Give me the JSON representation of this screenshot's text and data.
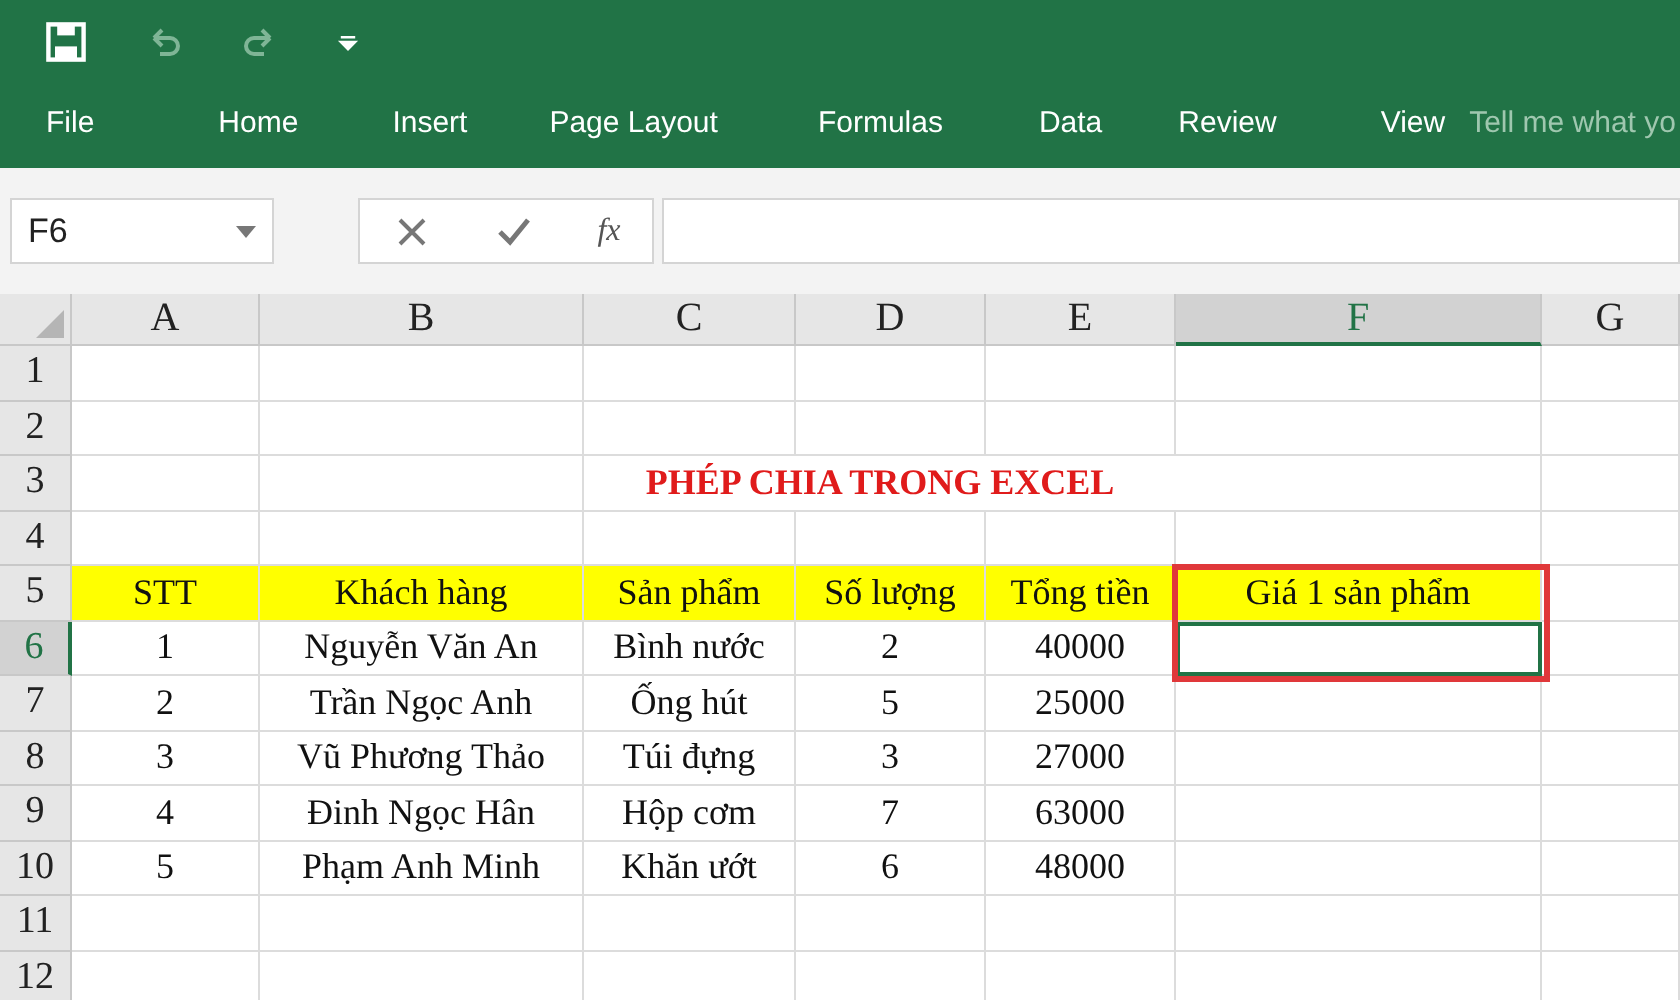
{
  "ribbon": {
    "tabs": [
      "File",
      "Home",
      "Insert",
      "Page Layout",
      "Formulas",
      "Data",
      "Review",
      "View"
    ],
    "tell_me": "Tell me what yo"
  },
  "formula_bar": {
    "name_box": "F6",
    "function_label": "fx"
  },
  "sheet": {
    "columns": [
      {
        "label": "A",
        "selected": false
      },
      {
        "label": "B",
        "selected": false
      },
      {
        "label": "C",
        "selected": false
      },
      {
        "label": "D",
        "selected": false
      },
      {
        "label": "E",
        "selected": false
      },
      {
        "label": "F",
        "selected": true
      },
      {
        "label": "G",
        "selected": false
      }
    ],
    "rows": [
      {
        "label": "1",
        "selected": false
      },
      {
        "label": "2",
        "selected": false
      },
      {
        "label": "3",
        "selected": false
      },
      {
        "label": "4",
        "selected": false
      },
      {
        "label": "5",
        "selected": false
      },
      {
        "label": "6",
        "selected": true
      },
      {
        "label": "7",
        "selected": false
      },
      {
        "label": "8",
        "selected": false
      },
      {
        "label": "9",
        "selected": false
      },
      {
        "label": "10",
        "selected": false
      },
      {
        "label": "11",
        "selected": false
      },
      {
        "label": "12",
        "selected": false
      }
    ],
    "title": "PHÉP CHIA TRONG EXCEL",
    "table": {
      "header": [
        {
          "label": "STT",
          "highlighted": false
        },
        {
          "label": "Khách hàng",
          "highlighted": false
        },
        {
          "label": "Sản phẩm",
          "highlighted": false
        },
        {
          "label": "Số lượng",
          "highlighted": false
        },
        {
          "label": "Tổng tiền",
          "highlighted": false
        },
        {
          "label": "Giá 1 sản phẩm",
          "highlighted": true
        }
      ],
      "rows": [
        [
          "1",
          "Nguyễn Văn An",
          "Bình nước",
          "2",
          "40000"
        ],
        [
          "2",
          "Trần Ngọc Anh",
          "Ống hút",
          "5",
          "25000"
        ],
        [
          "3",
          "Vũ Phương Thảo",
          "Túi đựng",
          "3",
          "27000"
        ],
        [
          "4",
          "Đinh Ngọc Hân",
          "Hộp cơm",
          "7",
          "63000"
        ],
        [
          "5",
          "Phạm Anh Minh",
          "Khăn ướt",
          "6",
          "48000"
        ]
      ]
    }
  }
}
